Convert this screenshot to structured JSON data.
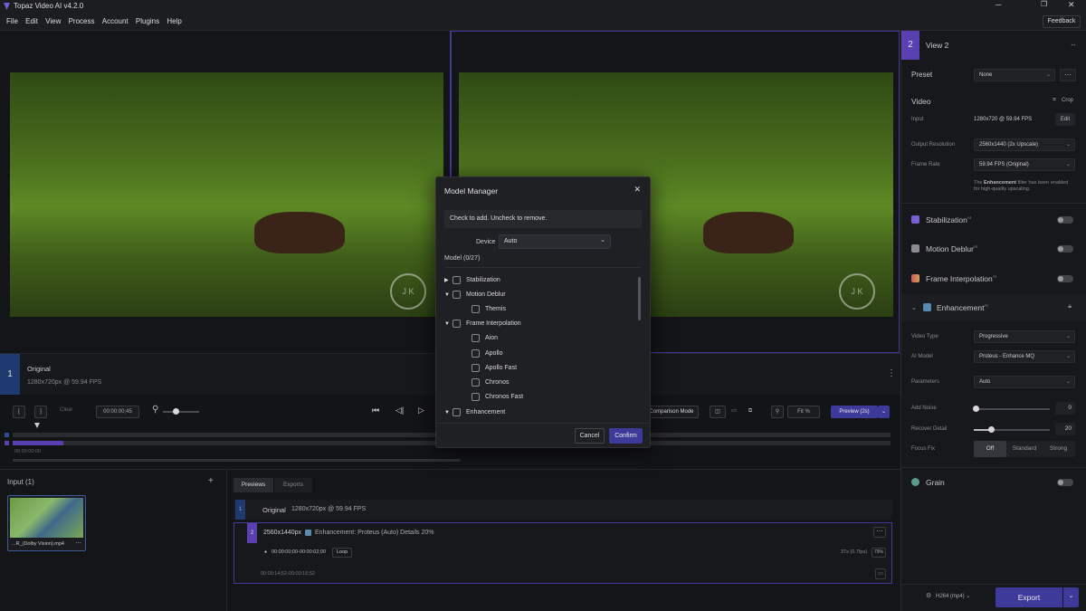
{
  "app": {
    "title": "Topaz Video AI  v4.2.0",
    "feedback": "Feedback"
  },
  "menu": [
    "File",
    "Edit",
    "View",
    "Process",
    "Account",
    "Plugins",
    "Help"
  ],
  "colors": {
    "accent": "#3e3a9a",
    "purple": "#5a3fb0",
    "bg": "#111214"
  },
  "viewer": {
    "watermark": "J K"
  },
  "info": {
    "index": "1",
    "title": "Original",
    "detail": "1280x720px @ 59.94 FPS"
  },
  "toolbar": {
    "clear": "Clear",
    "timecode": "00:00:00;45",
    "comparison": "Comparison Mode",
    "fit": "Fit %",
    "preview": "Preview (2s)",
    "time_start": "00:00:00:00"
  },
  "panel": {
    "view_index": "2",
    "view_name": "View 2",
    "preset_label": "Preset",
    "preset_value": "None",
    "video_label": "Video",
    "crop": "Crop",
    "input_label": "Input",
    "input_value": "1280x720 @ 59.94 FPS",
    "edit": "Edit",
    "outres_label": "Output Resolution",
    "outres_value": "2560x1440 (2x Upscale)",
    "fps_label": "Frame Rate",
    "fps_value": "59.94 FPS (Original)",
    "note_pre": "The ",
    "note_bold": "Enhancement",
    "note_post": " filter has been enabled for high-quality upscaling.",
    "stab": "Stabilization",
    "deblur": "Motion Deblur",
    "interp": "Frame Interpolation",
    "enh": "Enhancement",
    "ai": "AI",
    "vtype_label": "Video Type",
    "vtype_value": "Progressive",
    "model_label": "AI Model",
    "model_value": "Proteus - Enhance MQ",
    "params_label": "Parameters",
    "params_value": "Auto",
    "noise_label": "Add Noise",
    "noise_value": "0",
    "recover_label": "Recover Detail",
    "recover_value": "20",
    "focus_label": "Focus Fix",
    "focus_off": "Off",
    "focus_std": "Standard",
    "focus_strong": "Strong",
    "grain": "Grain",
    "format": "H264 (mp4)",
    "export": "Export"
  },
  "modal": {
    "title": "Model Manager",
    "hint": "Check to add. Uncheck to remove.",
    "device_label": "Device",
    "device_value": "Auto",
    "count": "Model (0/27)",
    "rows": [
      "Stabilization",
      "Motion Deblur",
      "Themis",
      "Frame Interpolation",
      "Aion",
      "Apollo",
      "Apollo Fast",
      "Chronos",
      "Chronos Fast",
      "Enhancement"
    ],
    "cancel": "Cancel",
    "confirm": "Confirm"
  },
  "input": {
    "title": "Input (1)",
    "file": "...R_(Dolby Vision).mp4"
  },
  "previews": {
    "tab_previews": "Previews",
    "tab_exports": "Exports",
    "row1_index": "1",
    "row1_name": "Original",
    "row1_detail": "1280x720px @ 59.94 FPS",
    "row2_index": "2",
    "row2_res": "2560x1440px",
    "row2_desc": "Enhancement: Proteus (Auto) Details 20%",
    "row2_range": "00:00:00;00-00:00:02;00",
    "loop": "Loop",
    "row2_speed": "37s (0.7fps)",
    "row2_pct": "79%",
    "row2_range2": "00:00:14;52-00:00:16;52"
  }
}
